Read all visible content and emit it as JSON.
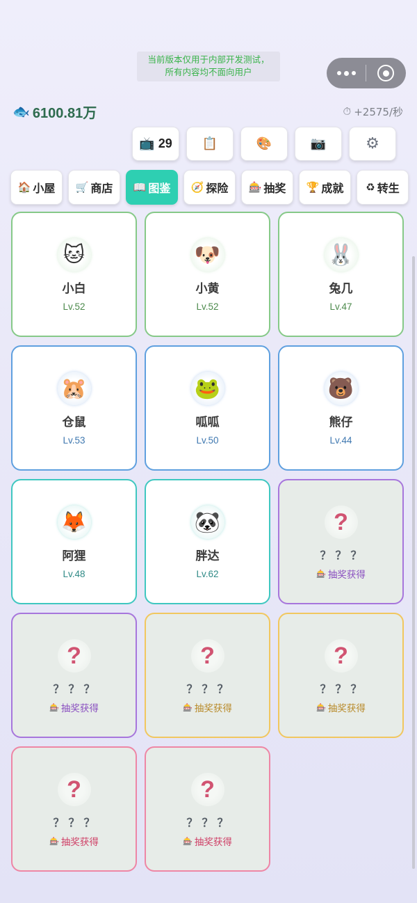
{
  "notice": {
    "line1": "当前版本仅用于内部开发测试，",
    "line2": "所有内容均不面向用户"
  },
  "currency": {
    "icon": "🐟",
    "value": "6100.81万"
  },
  "rate": {
    "icon": "⏱",
    "value": "+2575/秒"
  },
  "toolbar": {
    "tv": {
      "icon": "📺",
      "count": "29"
    },
    "clipboard": {
      "icon": "📋"
    },
    "palette": {
      "icon": "🎨"
    },
    "camera": {
      "icon": "📷"
    },
    "settings": {
      "icon": "⚙"
    }
  },
  "tabs": [
    {
      "icon": "🏠",
      "label": "小屋"
    },
    {
      "icon": "🛒",
      "label": "商店"
    },
    {
      "icon": "📖",
      "label": "图鉴"
    },
    {
      "icon": "🧭",
      "label": "探险"
    },
    {
      "icon": "🎰",
      "label": "抽奖"
    },
    {
      "icon": "🏆",
      "label": "成就"
    },
    {
      "icon": "♻",
      "label": "转生"
    }
  ],
  "pets": [
    {
      "emoji": "🐱",
      "name": "小白",
      "level": "Lv.52"
    },
    {
      "emoji": "🐶",
      "name": "小黄",
      "level": "Lv.52"
    },
    {
      "emoji": "🐰",
      "name": "兔几",
      "level": "Lv.47"
    },
    {
      "emoji": "🐹",
      "name": "仓鼠",
      "level": "Lv.53"
    },
    {
      "emoji": "🐸",
      "name": "呱呱",
      "level": "Lv.50"
    },
    {
      "emoji": "🐻",
      "name": "熊仔",
      "level": "Lv.44"
    },
    {
      "emoji": "🦊",
      "name": "阿狸",
      "level": "Lv.48"
    },
    {
      "emoji": "🐼",
      "name": "胖达",
      "level": "Lv.62"
    }
  ],
  "locked": {
    "mark": "?",
    "name": "？？？",
    "hint_icon": "🎰",
    "hint": "抽奖获得"
  }
}
